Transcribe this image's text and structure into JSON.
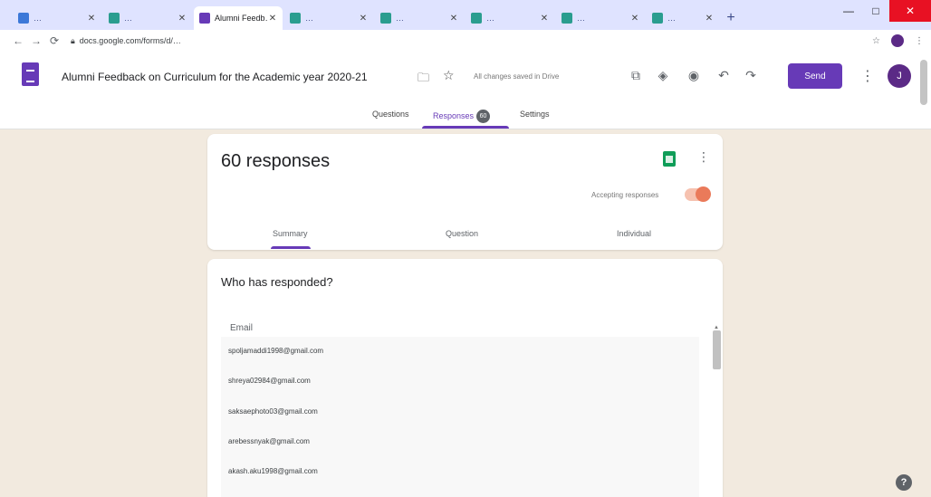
{
  "browser": {
    "tabs": [
      {
        "label": "…",
        "favicon_color": "#3c78d8"
      },
      {
        "label": "…",
        "favicon_color": "#2a9d8f"
      },
      {
        "label": "Alumni Feedb…",
        "favicon_color": "#673ab7"
      },
      {
        "label": "…",
        "favicon_color": "#2a9d8f"
      },
      {
        "label": "…",
        "favicon_color": "#2a9d8f"
      },
      {
        "label": "…",
        "favicon_color": "#2a9d8f"
      },
      {
        "label": "…",
        "favicon_color": "#2a9d8f"
      },
      {
        "label": "…",
        "favicon_color": "#2a9d8f"
      }
    ],
    "active_tab_index": 2,
    "new_tab": "+",
    "url": "docs.google.com/forms/d/…",
    "window_controls": {
      "minimize": "—",
      "maximize": "□",
      "close": "✕"
    }
  },
  "header": {
    "title": "Alumni Feedback on Curriculum for the Academic year 2020-21",
    "saved_status": "All changes saved in Drive",
    "send_label": "Send",
    "avatar_initial": "J",
    "tabs": [
      {
        "label": "Questions"
      },
      {
        "label": "Responses",
        "badge": "60"
      },
      {
        "label": "Settings"
      }
    ]
  },
  "summary": {
    "count_text": "60 responses",
    "accepting_label": "Accepting responses",
    "accepting": true,
    "tabs": [
      "Summary",
      "Question",
      "Individual"
    ],
    "active_tab": "Summary"
  },
  "who": {
    "title": "Who has responded?",
    "column_header": "Email",
    "emails": [
      "spoljamaddi1998@gmail.com",
      "shreya02984@gmail.com",
      "saksaephoto03@gmail.com",
      "arebessnyak@gmail.com",
      "akash.aku1998@gmail.com"
    ]
  },
  "colors": {
    "accent": "#673ab7",
    "page_bg": "#f2eadf",
    "sheets_green": "#0f9d58",
    "toggle": "#ea7a5a"
  }
}
